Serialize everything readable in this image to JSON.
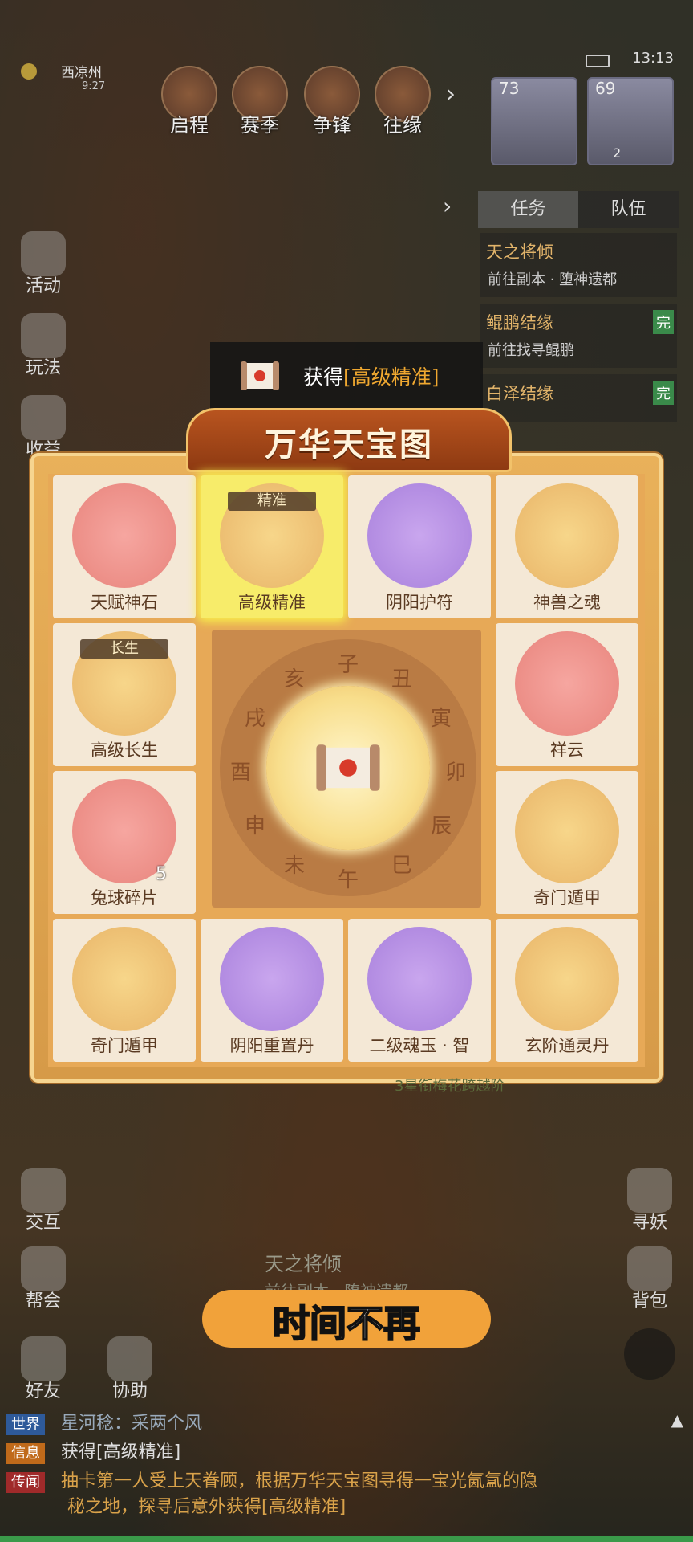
{
  "hud": {
    "location": "西凉州",
    "loc_time": "9:27",
    "clock": "13:13",
    "nav": [
      "启程",
      "赛季",
      "争锋",
      "往缘"
    ],
    "avatars": [
      {
        "level": "73"
      },
      {
        "level": "69",
        "badge": "2"
      }
    ]
  },
  "tasks": {
    "tabs": [
      "任务",
      "队伍"
    ],
    "items": [
      {
        "title": "天之将倾",
        "icon": "赛",
        "sub": "前往副本 · 堕神遗都"
      },
      {
        "title": "鲲鹏结缘",
        "icon": "妖",
        "sub": "前往找寻鲲鹏",
        "done": "完"
      },
      {
        "title": "白泽结缘",
        "icon": "缘",
        "sub": "",
        "done": "完"
      }
    ]
  },
  "side_left": [
    "活动",
    "玩法",
    "收益"
  ],
  "banner": {
    "prefix": "获得",
    "item": "[高级精准]"
  },
  "board": {
    "title": "万华天宝图",
    "cells": [
      {
        "label": "天赋神石",
        "color": "red"
      },
      {
        "label": "高级精准",
        "color": "gold",
        "tag": "精准",
        "selected": true
      },
      {
        "label": "阴阳护符",
        "color": "purple"
      },
      {
        "label": "神兽之魂",
        "color": "gold"
      },
      {
        "label": "高级长生",
        "color": "gold",
        "tag": "长生"
      },
      {
        "label": "祥云",
        "color": "red"
      },
      {
        "label": "兔球碎片",
        "color": "red",
        "count": "5"
      },
      {
        "label": "奇门遁甲",
        "color": "gold"
      },
      {
        "label": "奇门遁甲",
        "color": "gold"
      },
      {
        "label": "阴阳重置丹",
        "color": "purple"
      },
      {
        "label": "二级魂玉 · 智",
        "color": "purple"
      },
      {
        "label": "玄阶通灵丹",
        "color": "gold"
      }
    ],
    "wheel_chars": [
      "子",
      "丑",
      "寅",
      "卯",
      "辰",
      "巳",
      "午",
      "未",
      "申",
      "酉",
      "戌",
      "亥"
    ]
  },
  "ghost": {
    "task_title": "天之将倾",
    "task_sub": "前往副本 · 堕神遗都",
    "line": "3星衔梅花跨越阶"
  },
  "side_bottom_left": [
    "交互",
    "帮会",
    "好友",
    "协助"
  ],
  "side_bottom_right": [
    "寻妖",
    "背包"
  ],
  "subtitle": "时间不再",
  "chat": [
    {
      "channel": "世界",
      "text": "星河稔：采两个风"
    },
    {
      "channel": "信息",
      "text": "获得[高级精准]"
    },
    {
      "channel": "传闻",
      "text": "抽卡第一人受上天眷顾，根据万华天宝图寻得一宝光氤氲的隐"
    },
    {
      "channel": "",
      "text": "秘之地，探寻后意外获得[高级精准]"
    }
  ],
  "colors": {
    "accent": "#f0a830",
    "board": "#e7a957",
    "selected": "#f7ec6a"
  }
}
